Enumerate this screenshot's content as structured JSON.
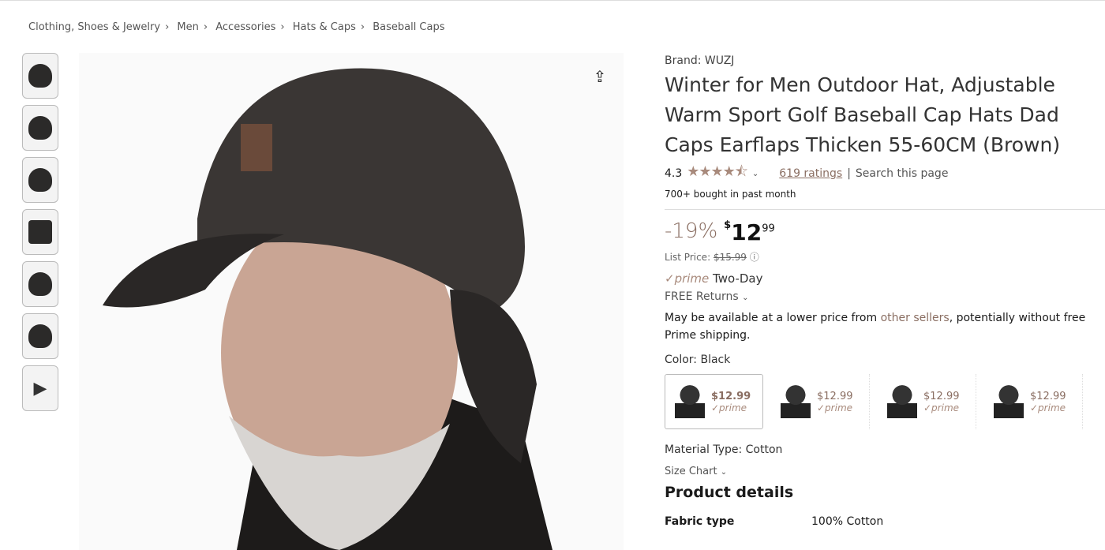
{
  "breadcrumb": [
    "Clothing, Shoes & Jewelry",
    "Men",
    "Accessories",
    "Hats & Caps",
    "Baseball Caps"
  ],
  "thumbnails": [
    "thumb-1",
    "thumb-2",
    "thumb-3",
    "thumb-4",
    "thumb-5",
    "thumb-6",
    "video-thumb"
  ],
  "product": {
    "brand": "Brand: WUZJ",
    "title": "Winter for Men Outdoor Hat, Adjustable Warm Sport Golf Baseball Cap Hats Dad Caps Earflaps Thicken 55-60CM (Brown)",
    "rating": "4.3",
    "stars": "★★★★⯪",
    "rating_fraction": 0.86,
    "ratings_count": "619 ratings",
    "search_page": "Search this page",
    "bought": "700+ bought in past month",
    "discount": "-19%",
    "price_symbol": "$",
    "price_whole": "12",
    "price_fraction": "99",
    "list_price_label": "List Price:",
    "list_price": "$15.99",
    "prime": "✓prime",
    "prime_delivery": "Two-Day",
    "returns": "FREE Returns",
    "availability_pre": "May be available at a lower price from ",
    "availability_link": "other sellers",
    "availability_post": ", potentially without free Prime shipping.",
    "color_label": "Color: Black",
    "swatches": [
      {
        "price": "$12.99",
        "prime": "✓prime"
      },
      {
        "price": "$12.99",
        "prime": "✓prime"
      },
      {
        "price": "$12.99",
        "prime": "✓prime"
      },
      {
        "price": "$12.99",
        "prime": "✓prime"
      }
    ],
    "material": "Material Type: Cotton",
    "size_chart": "Size Chart",
    "details_heading": "Product details",
    "details": [
      {
        "label": "Fabric type",
        "value": "100% Cotton"
      }
    ]
  },
  "colors": {
    "accent": "#8a6e62",
    "stars": "#a88a7c"
  }
}
